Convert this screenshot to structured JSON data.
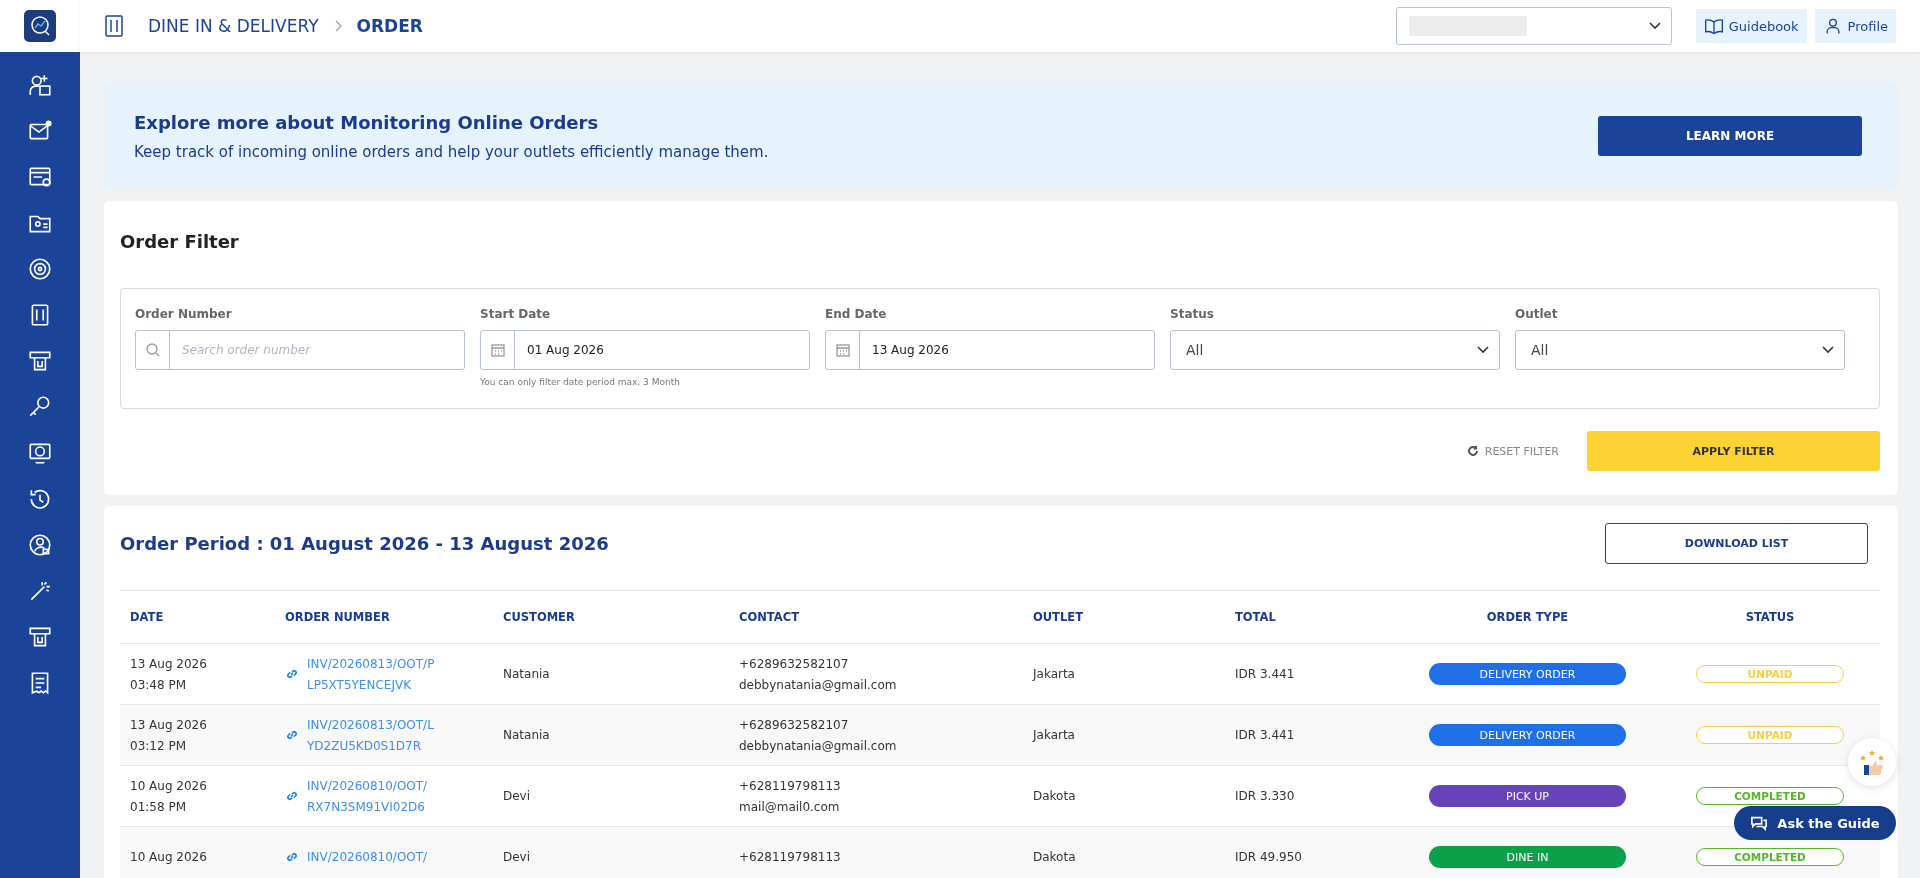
{
  "header": {
    "breadcrumb": [
      {
        "label": "DINE IN & DELIVERY",
        "selected": false
      },
      {
        "label": "ORDER",
        "selected": true
      }
    ],
    "guidebook": "Guidebook",
    "profile": "Profile"
  },
  "banner": {
    "title": "Explore more about Monitoring Online Orders",
    "text": "Keep track of incoming online orders and help your outlets efficiently manage them.",
    "button": "LEARN MORE"
  },
  "filter": {
    "title": "Order Filter",
    "fields": [
      {
        "kind": "search",
        "label": "Order Number",
        "placeholder": "Search order number"
      },
      {
        "kind": "date",
        "label": "Start Date",
        "value": "01 Aug 2026",
        "hint": "You can only filter date period max. 3 Month"
      },
      {
        "kind": "date",
        "label": "End Date",
        "value": "13 Aug 2026"
      },
      {
        "kind": "select",
        "label": "Status",
        "value": "All"
      },
      {
        "kind": "select",
        "label": "Outlet",
        "value": "All"
      }
    ],
    "reset": "RESET FILTER",
    "apply": "APPLY FILTER"
  },
  "orders": {
    "title": "Order Period : 01 August 2026 - 13 August 2026",
    "download": "DOWNLOAD LIST",
    "columns": [
      "DATE",
      "ORDER NUMBER",
      "CUSTOMER",
      "CONTACT",
      "OUTLET",
      "TOTAL",
      "ORDER TYPE",
      "STATUS"
    ],
    "rows": [
      {
        "date": "13 Aug 2026",
        "time": "03:48 PM",
        "order": [
          "INV/20260813/OOT/P",
          "LP5XT5YENCEJVK"
        ],
        "customer": "Natania",
        "phone": "+6289632582107",
        "email": "debbynatania@gmail.com",
        "outlet": "Jakarta",
        "total": "IDR 3.441",
        "type": {
          "kind": "delivery",
          "label": "DELIVERY ORDER"
        },
        "status": {
          "kind": "unpaid",
          "label": "UNPAID"
        }
      },
      {
        "date": "13 Aug 2026",
        "time": "03:12 PM",
        "order": [
          "INV/20260813/OOT/L",
          "YD2ZU5KD0S1D7R"
        ],
        "customer": "Natania",
        "phone": "+6289632582107",
        "email": "debbynatania@gmail.com",
        "outlet": "Jakarta",
        "total": "IDR 3.441",
        "type": {
          "kind": "delivery",
          "label": "DELIVERY ORDER"
        },
        "status": {
          "kind": "unpaid",
          "label": "UNPAID"
        }
      },
      {
        "date": "10 Aug 2026",
        "time": "01:58 PM",
        "order": [
          "INV/20260810/OOT/",
          "RX7N3SM91VI02D6"
        ],
        "customer": "Devi",
        "phone": "+628119798113",
        "email": "mail@mail0.com",
        "outlet": "Dakota",
        "total": "IDR 3.330",
        "type": {
          "kind": "pickup",
          "label": "PICK UP"
        },
        "status": {
          "kind": "completed",
          "label": "COMPLETED"
        }
      },
      {
        "date": "10 Aug 2026",
        "order": [
          "INV/20260810/OOT/"
        ],
        "customer": "Devi",
        "phone": "+628119798113",
        "outlet": "Dakota",
        "total": "IDR 49.950",
        "type": {
          "kind": "dinein",
          "label": "DINE IN"
        },
        "status": {
          "kind": "completed",
          "label": "COMPLETED"
        }
      }
    ]
  },
  "ask_guide": "Ask the Guide"
}
